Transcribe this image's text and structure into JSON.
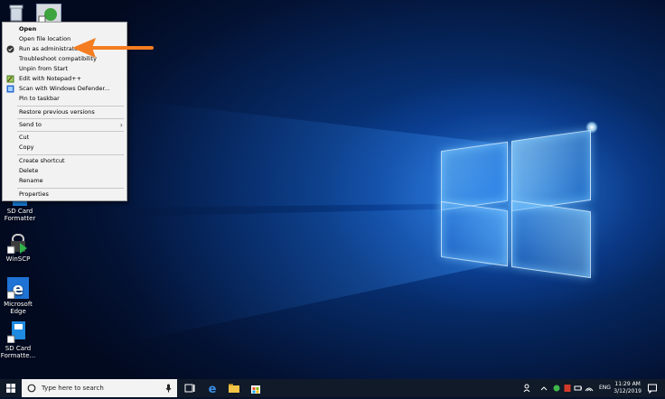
{
  "context_menu": {
    "items": [
      {
        "label": "Open",
        "bold": true,
        "icon": ""
      },
      {
        "label": "Open file location",
        "icon": ""
      },
      {
        "label": "Run as administrator",
        "icon": "shield-check-icon"
      },
      {
        "label": "Troubleshoot compatibility",
        "icon": ""
      },
      {
        "label": "Unpin from Start",
        "icon": ""
      },
      {
        "label": "Edit with Notepad++",
        "icon": "notepad-plus-icon"
      },
      {
        "label": "Scan with Windows Defender...",
        "icon": "defender-icon"
      },
      {
        "label": "Pin to taskbar",
        "icon": ""
      },
      {
        "label": "Restore previous versions",
        "icon": ""
      },
      {
        "label": "Send to",
        "icon": "",
        "submenu": true
      },
      {
        "label": "Cut",
        "icon": ""
      },
      {
        "label": "Copy",
        "icon": ""
      },
      {
        "label": "Create shortcut",
        "icon": ""
      },
      {
        "label": "Delete",
        "icon": ""
      },
      {
        "label": "Rename",
        "icon": ""
      },
      {
        "label": "Properties",
        "icon": ""
      }
    ]
  },
  "desktop_icons": [
    {
      "label_1": "SD Card",
      "label_2": "Formatter"
    },
    {
      "label_1": "WinSCP",
      "label_2": ""
    },
    {
      "label_1": "Microsoft",
      "label_2": "Edge"
    },
    {
      "label_1": "SD Card",
      "label_2": "Formatte..."
    }
  ],
  "taskbar": {
    "search_placeholder": "Type here to search",
    "language": "ENG",
    "time": "11:29 AM",
    "date": "3/12/2019"
  },
  "colors": {
    "accent_arrow": "#f57c20",
    "taskbar": "#101a28",
    "menu_bg": "#f2f2f2"
  }
}
